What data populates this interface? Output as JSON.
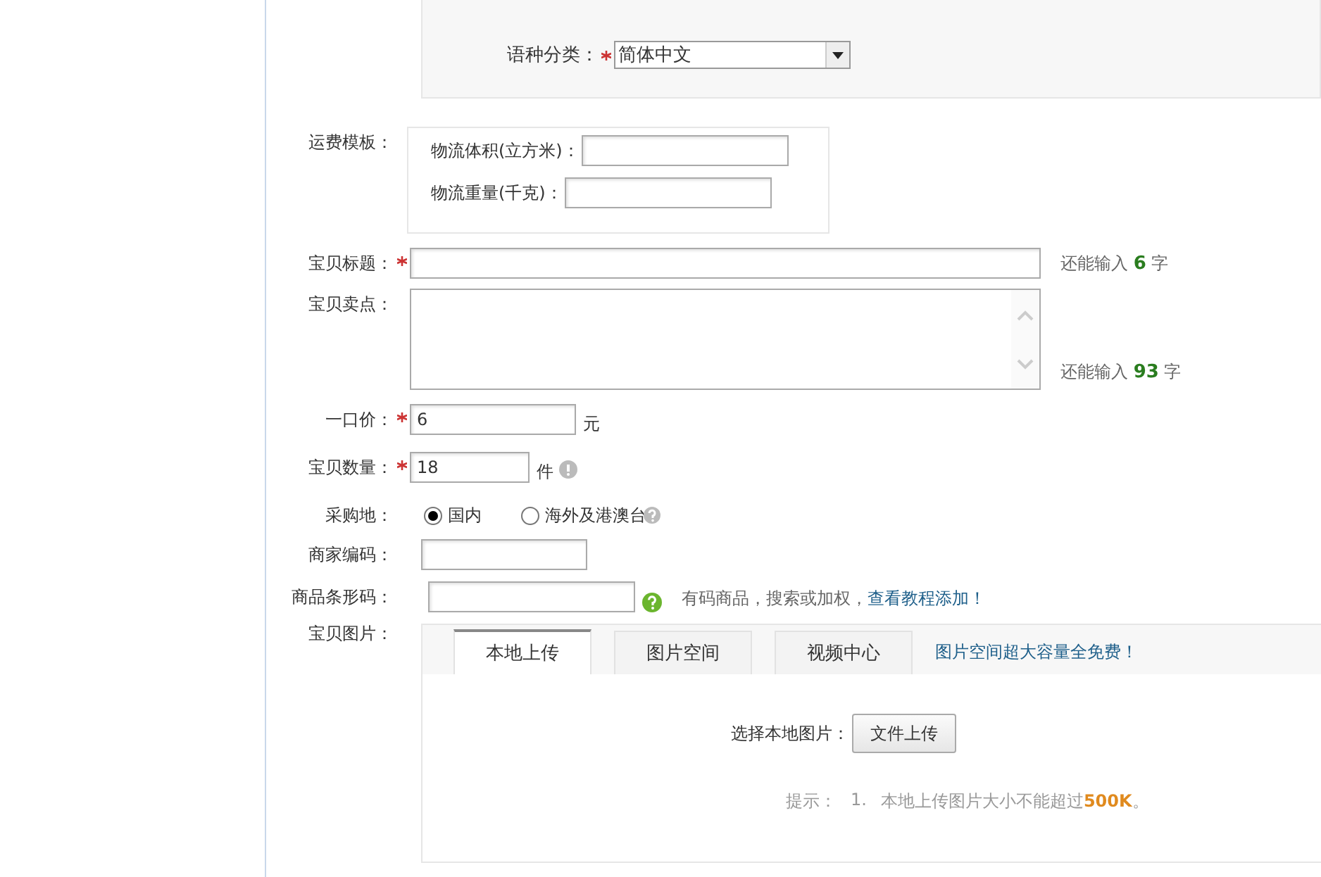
{
  "language": {
    "label": "语种分类：",
    "value": "简体中文",
    "required": true
  },
  "freight": {
    "label": "运费模板：",
    "volume_label": "物流体积(立方米)：",
    "weight_label": "物流重量(千克)："
  },
  "title": {
    "label": "宝贝标题：",
    "required": true,
    "counter": "还能输入 **6** 字"
  },
  "selling_point": {
    "label": "宝贝卖点：",
    "counter": "还能输入 **93** 字"
  },
  "price": {
    "label": "一口价：",
    "required": true,
    "value": "6",
    "unit": "元"
  },
  "quantity": {
    "label": "宝贝数量：",
    "required": true,
    "value": "18",
    "unit": "件"
  },
  "purchase_location": {
    "label": "采购地：",
    "options": [
      {
        "label": "国内",
        "selected": true
      },
      {
        "label": "海外及港澳台",
        "selected": false
      }
    ]
  },
  "merchant_code": {
    "label": "商家编码："
  },
  "barcode": {
    "label": "商品条形码：",
    "hint": "有码商品，搜索或加权，",
    "link": "查看教程添加！"
  },
  "images": {
    "label": "宝贝图片：",
    "tabs": [
      {
        "label": "本地上传",
        "selected": true
      },
      {
        "label": "图片空间",
        "selected": false
      },
      {
        "label": "视频中心",
        "selected": false
      }
    ],
    "promo": "图片空间超大容量全免费！",
    "select_label": "选择本地图片：",
    "upload_button": "文件上传",
    "tip_label": "提示：",
    "tips": [
      {
        "number": "1.",
        "text": "本地上传图片大小不能超过**500K**。"
      }
    ]
  }
}
